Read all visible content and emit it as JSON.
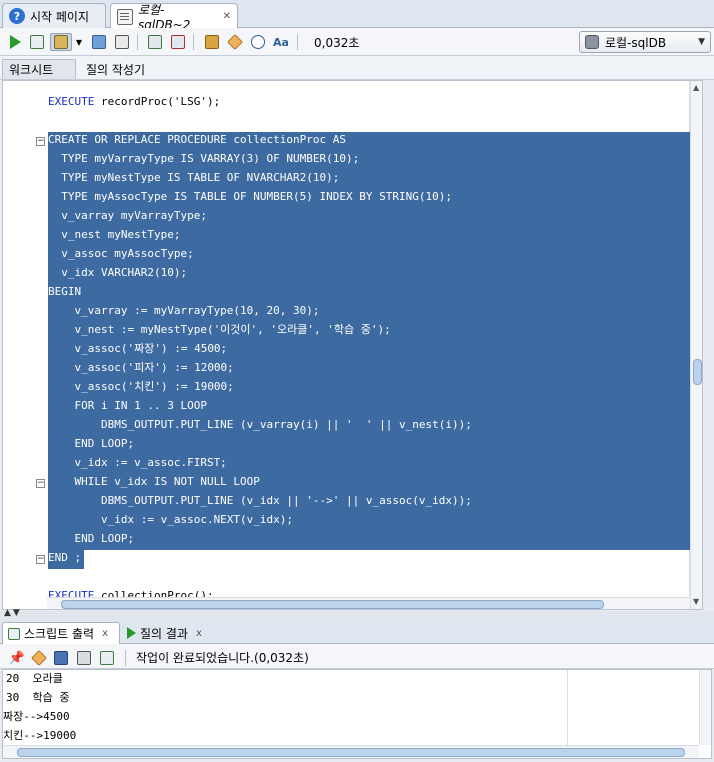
{
  "doc_tabs": [
    {
      "label": "시작 페이지",
      "icon": "help-icon"
    },
    {
      "label": "로컬-sqlDB~2",
      "icon": "sql-worksheet-icon",
      "active": true
    }
  ],
  "toolbar": {
    "elapsed": "0,032초",
    "connection": "로컬-sqlDB"
  },
  "sub_tabs": [
    "워크시트",
    "질의 작성기"
  ],
  "editor": {
    "lines": [
      {
        "text": "EXECUTE recordProc('LSG');"
      },
      {
        "text": ""
      },
      {
        "text": "CREATE OR REPLACE PROCEDURE collectionProc AS"
      },
      {
        "text": "  TYPE myVarrayType IS VARRAY(3) OF NUMBER(10);"
      },
      {
        "text": "  TYPE myNestType IS TABLE OF NVARCHAR2(10);"
      },
      {
        "text": "  TYPE myAssocType IS TABLE OF NUMBER(5) INDEX BY STRING(10);"
      },
      {
        "text": "  v_varray myVarrayType;"
      },
      {
        "text": "  v_nest myNestType;"
      },
      {
        "text": "  v_assoc myAssocType;"
      },
      {
        "text": "  v_idx VARCHAR2(10);"
      },
      {
        "text": "BEGIN"
      },
      {
        "text": "    v_varray := myVarrayType(10, 20, 30);"
      },
      {
        "text": "    v_nest := myNestType('이것이', '오라클', '학습 중');"
      },
      {
        "text": "    v_assoc('짜장') := 4500;"
      },
      {
        "text": "    v_assoc('피자') := 12000;"
      },
      {
        "text": "    v_assoc('치킨') := 19000;"
      },
      {
        "text": "    FOR i IN 1 .. 3 LOOP"
      },
      {
        "text": "        DBMS_OUTPUT.PUT_LINE (v_varray(i) || '  ' || v_nest(i));"
      },
      {
        "text": "    END LOOP;"
      },
      {
        "text": "    v_idx := v_assoc.FIRST;"
      },
      {
        "text": "    WHILE v_idx IS NOT NULL LOOP"
      },
      {
        "text": "        DBMS_OUTPUT.PUT_LINE (v_idx || '-->' || v_assoc(v_idx));"
      },
      {
        "text": "        v_idx := v_assoc.NEXT(v_idx);"
      },
      {
        "text": "    END LOOP;"
      },
      {
        "text": "END ;"
      },
      {
        "text": ""
      },
      {
        "text": "EXECUTE collectionProc();"
      }
    ]
  },
  "output_tabs": [
    "스크립트 출력",
    "질의 결과"
  ],
  "output": {
    "status": "작업이 완료되었습니다.(0,032초)",
    "lines": [
      "20  오라클",
      "30  학습 중",
      "짜장-->4500",
      "치킨-->19000"
    ]
  },
  "colors": {
    "selection": "#3d6aa0",
    "keyword": "#1a2fc7",
    "run_green": "#2a9a2a"
  }
}
